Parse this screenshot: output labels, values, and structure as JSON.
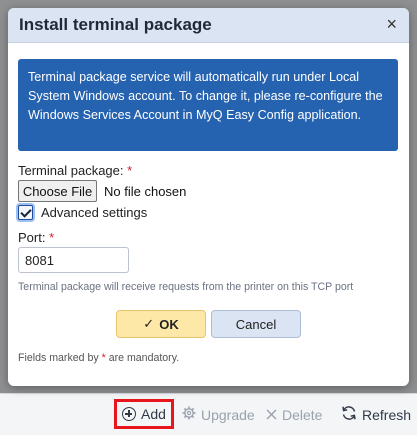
{
  "dialog": {
    "title": "Install terminal package",
    "close_glyph": "×",
    "info_text": "Terminal package service will automatically run under Local System Windows account. To change it, please re-configure the Windows Services Account in MyQ Easy Config application.",
    "terminal_package_label": "Terminal package:",
    "required_mark": "*",
    "choose_file_label": "Choose File",
    "file_status": "No file chosen",
    "advanced_settings_label": "Advanced settings",
    "advanced_settings_checked": true,
    "port_label": "Port:",
    "port_value": "8081",
    "port_hint": "Terminal package will receive requests from the printer on this TCP port",
    "ok_label": "OK",
    "cancel_label": "Cancel",
    "footnote_prefix": "Fields marked by",
    "footnote_suffix": "are mandatory."
  },
  "toolbar": {
    "add_label": "Add",
    "upgrade_label": "Upgrade",
    "delete_label": "Delete",
    "refresh_label": "Refresh"
  },
  "icons": {
    "add": "plus-circle-icon",
    "upgrade": "gear-icon",
    "delete": "x-icon",
    "refresh": "refresh-icon",
    "ok": "check-icon",
    "close": "close-icon"
  },
  "colors": {
    "info_box": "#2562b0",
    "header": "#dbe4f2",
    "ok_button": "#fde8a8",
    "highlight": "#e8161c",
    "required": "#d0202a"
  }
}
